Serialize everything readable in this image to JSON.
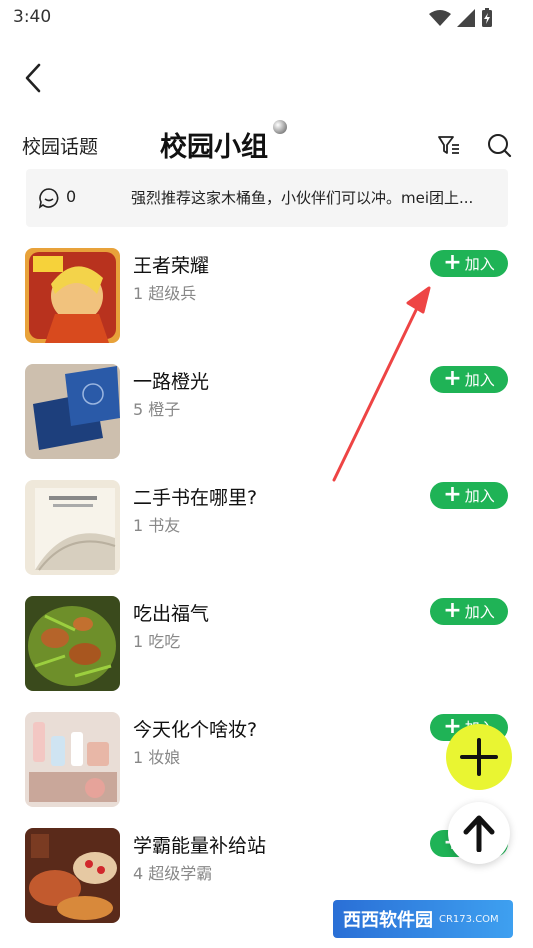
{
  "status_bar": {
    "time": "3:40"
  },
  "tabs": {
    "topic_label": "校园话题",
    "group_label": "校园小组"
  },
  "notice": {
    "count": "0",
    "text": "强烈推荐这家木桶鱼，小伙伴们可以冲。mei团上..."
  },
  "join_label": "加入",
  "groups": [
    {
      "title": "王者荣耀",
      "subtitle": "1 超级兵"
    },
    {
      "title": "一路橙光",
      "subtitle": "5 橙子"
    },
    {
      "title": "二手书在哪里?",
      "subtitle": "1 书友"
    },
    {
      "title": "吃出福气",
      "subtitle": "1 吃吃"
    },
    {
      "title": "今天化个啥妆?",
      "subtitle": "1 妆娘"
    },
    {
      "title": "学霸能量补给站",
      "subtitle": "4 超级学霸"
    }
  ],
  "watermark": {
    "main": "西西软件园",
    "sub": "CR173.COM"
  },
  "colors": {
    "join_green": "#1fb356",
    "fab_yellow": "#e9f532",
    "annotation_red": "#ee4444"
  }
}
